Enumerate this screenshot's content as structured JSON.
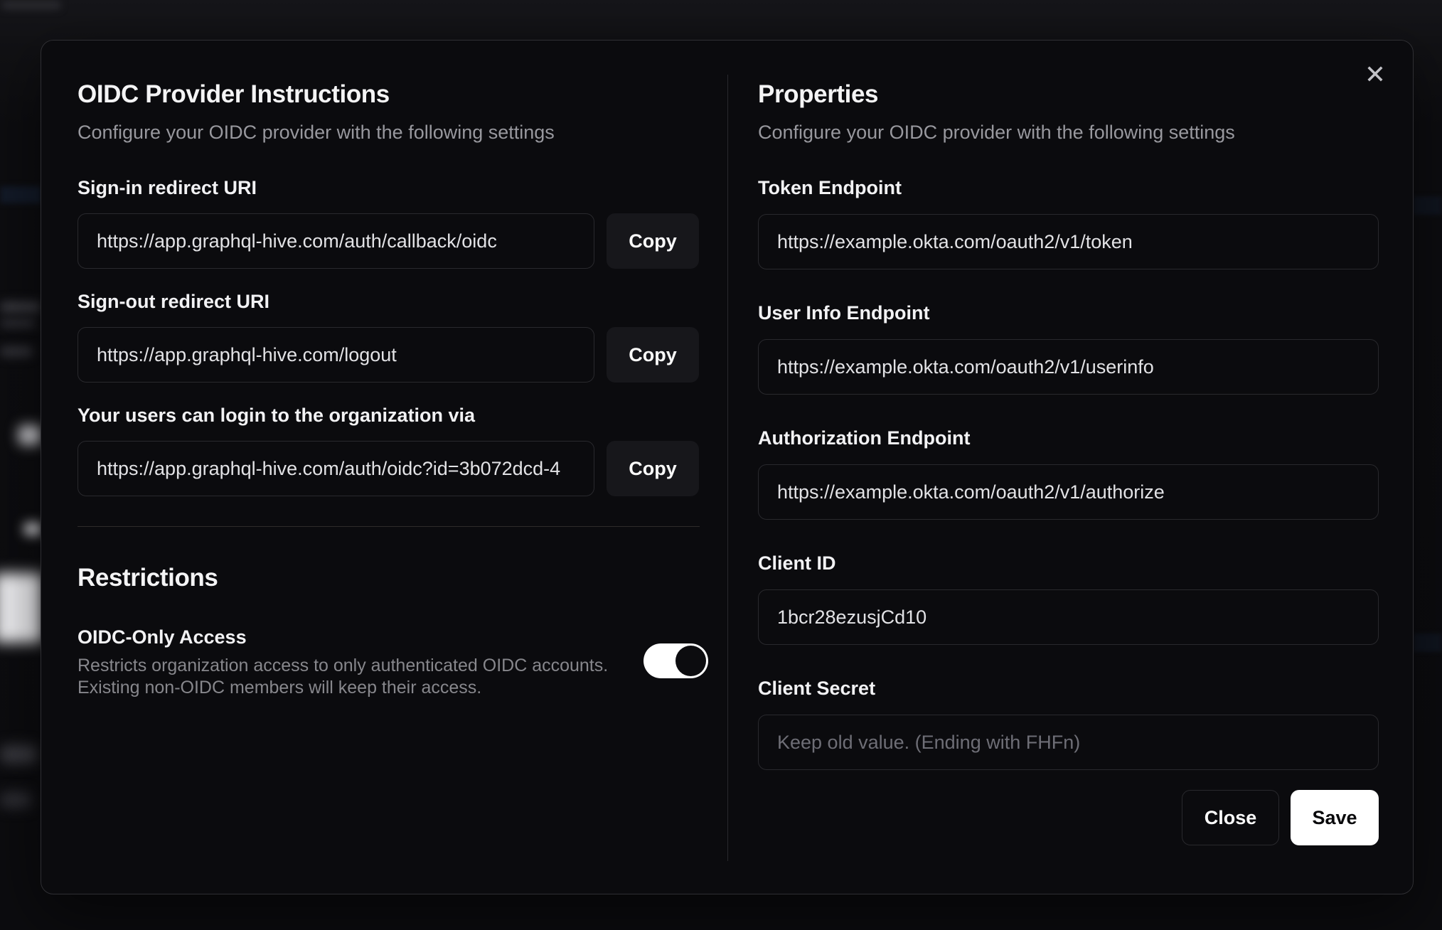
{
  "modal": {
    "close_icon": "✕",
    "left": {
      "title": "OIDC Provider Instructions",
      "subtitle": "Configure your OIDC provider with the following settings",
      "fields": [
        {
          "label": "Sign-in redirect URI",
          "value": "https://app.graphql-hive.com/auth/callback/oidc",
          "copy_label": "Copy"
        },
        {
          "label": "Sign-out redirect URI",
          "value": "https://app.graphql-hive.com/logout",
          "copy_label": "Copy"
        },
        {
          "label": "Your users can login to the organization via",
          "value": "https://app.graphql-hive.com/auth/oidc?id=3b072dcd-4",
          "copy_label": "Copy"
        }
      ],
      "restrictions": {
        "title": "Restrictions",
        "toggle_label": "OIDC-Only Access",
        "toggle_description_line1": "Restricts organization access to only authenticated OIDC accounts.",
        "toggle_description_line2": "Existing non-OIDC members will keep their access.",
        "toggle_state": "on"
      }
    },
    "right": {
      "title": "Properties",
      "subtitle": "Configure your OIDC provider with the following settings",
      "fields": [
        {
          "label": "Token Endpoint",
          "value": "https://example.okta.com/oauth2/v1/token"
        },
        {
          "label": "User Info Endpoint",
          "value": "https://example.okta.com/oauth2/v1/userinfo"
        },
        {
          "label": "Authorization Endpoint",
          "value": "https://example.okta.com/oauth2/v1/authorize"
        },
        {
          "label": "Client ID",
          "value": "1bcr28ezusjCd10"
        },
        {
          "label": "Client Secret",
          "value": "",
          "placeholder": "Keep old value. (Ending with FHFn)"
        }
      ],
      "buttons": {
        "close": "Close",
        "save": "Save"
      }
    }
  },
  "colors": {
    "modal_background": "#0b0b0e",
    "modal_border": "#2f2f33",
    "input_border": "#29292d",
    "copy_button_background": "#17171b",
    "save_button_background": "#ffffff",
    "save_button_text": "#09090b",
    "toggle_on_track": "#ffffff",
    "toggle_thumb": "#0c0c0f",
    "subtitle_text": "#98989e",
    "description_text": "#87878c"
  }
}
